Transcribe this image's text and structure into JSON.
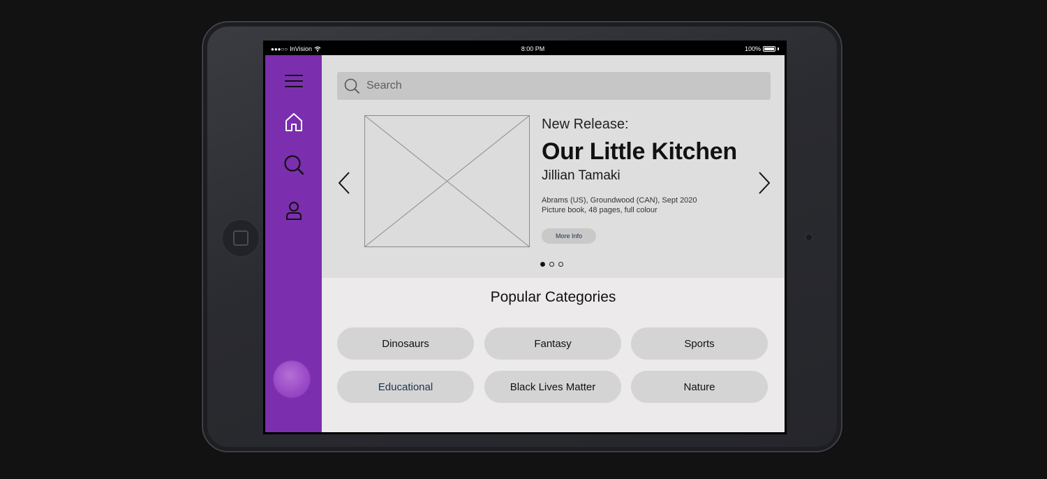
{
  "statusbar": {
    "carrier": "InVision",
    "time": "8:00 PM",
    "battery": "100%"
  },
  "sidebar": {
    "icons": [
      "menu-icon",
      "home-icon",
      "search-icon",
      "user-icon"
    ],
    "accent_color": "#7b2fae"
  },
  "search": {
    "placeholder": "Search"
  },
  "featured": {
    "eyebrow": "New Release:",
    "title": "Our Little Kitchen",
    "author": "Jillian Tamaki",
    "publisher": "Abrams (US), Groundwood (CAN), Sept 2020",
    "details": "Picture book, 48 pages, full colour",
    "button": "More Info",
    "carousel_active_index": 1,
    "carousel_count": 3
  },
  "categories": {
    "title": "Popular Categories",
    "items": [
      "Dinosaurs",
      "Fantasy",
      "Sports",
      "Educational",
      "Black Lives Matter",
      "Nature"
    ]
  }
}
